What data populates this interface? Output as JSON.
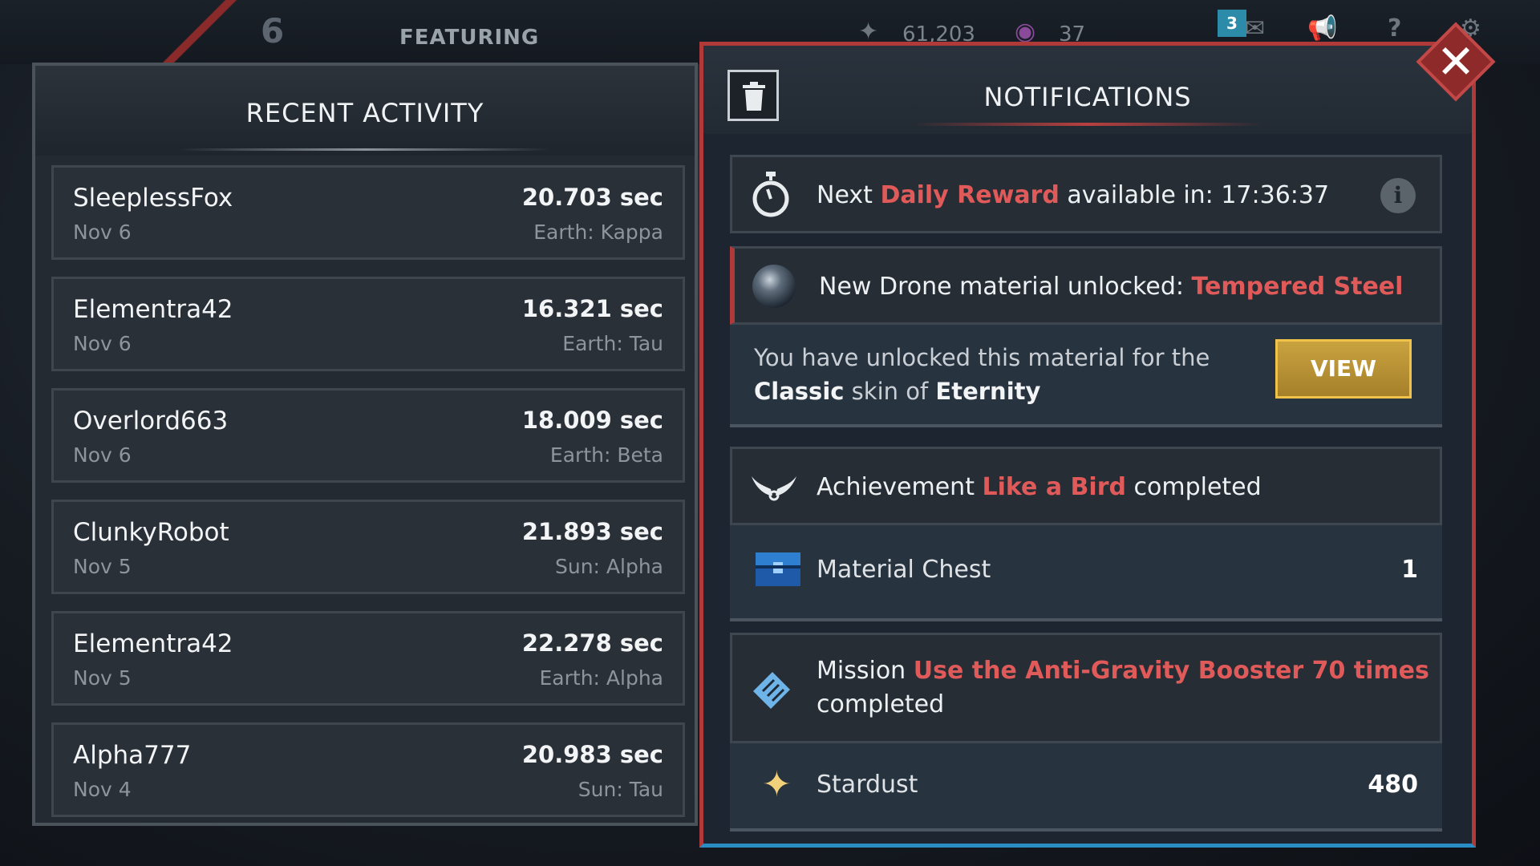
{
  "topbar": {
    "level": "6",
    "tab_label": "FEATURING",
    "stardust_count": "61,203",
    "gems_count": "37",
    "mail_badge": "3"
  },
  "recent_activity": {
    "title": "RECENT ACTIVITY",
    "rows": [
      {
        "name": "SleeplessFox",
        "date": "Nov 6",
        "time": "20.703 sec",
        "location": "Earth: Kappa"
      },
      {
        "name": "Elementra42",
        "date": "Nov 6",
        "time": "16.321 sec",
        "location": "Earth: Tau"
      },
      {
        "name": "Overlord663",
        "date": "Nov 6",
        "time": "18.009 sec",
        "location": "Earth: Beta"
      },
      {
        "name": "ClunkyRobot",
        "date": "Nov 5",
        "time": "21.893 sec",
        "location": "Sun: Alpha"
      },
      {
        "name": "Elementra42",
        "date": "Nov 5",
        "time": "22.278 sec",
        "location": "Earth: Alpha"
      },
      {
        "name": "Alpha777",
        "date": "Nov 4",
        "time": "20.983 sec",
        "location": "Sun: Tau"
      }
    ]
  },
  "notifications": {
    "title": "NOTIFICATIONS",
    "daily": {
      "prefix": "Next",
      "highlight": "Daily Reward",
      "suffix": "available in:",
      "timer": "17:36:37"
    },
    "drone": {
      "prefix": "New Drone material unlocked:",
      "highlight": "Tempered Steel",
      "detail_prefix": "You have unlocked this material for the",
      "detail_skin": "Classic",
      "detail_mid": "skin of",
      "detail_drone": "Eternity",
      "view_label": "VIEW"
    },
    "achievement": {
      "prefix": "Achievement",
      "highlight": "Like a Bird",
      "suffix": "completed",
      "reward_label": "Material Chest",
      "reward_qty": "1"
    },
    "mission": {
      "prefix": "Mission",
      "highlight": "Use the Anti-Gravity Booster 70 times",
      "suffix": "completed",
      "reward_label": "Stardust",
      "reward_qty": "480"
    }
  },
  "colors": {
    "highlight": "#e05a5a",
    "view_button": "#c9a33f",
    "panel_border_red": "#b03a3a",
    "panel_border_blue": "#2a8ec4"
  },
  "icons": [
    "trash-icon",
    "close-icon",
    "stopwatch-icon",
    "info-icon",
    "drone-sphere-icon",
    "wings-icon",
    "chest-icon",
    "scroll-icon",
    "stardust-icon",
    "mail-icon",
    "megaphone-icon",
    "help-icon",
    "gear-icon"
  ]
}
